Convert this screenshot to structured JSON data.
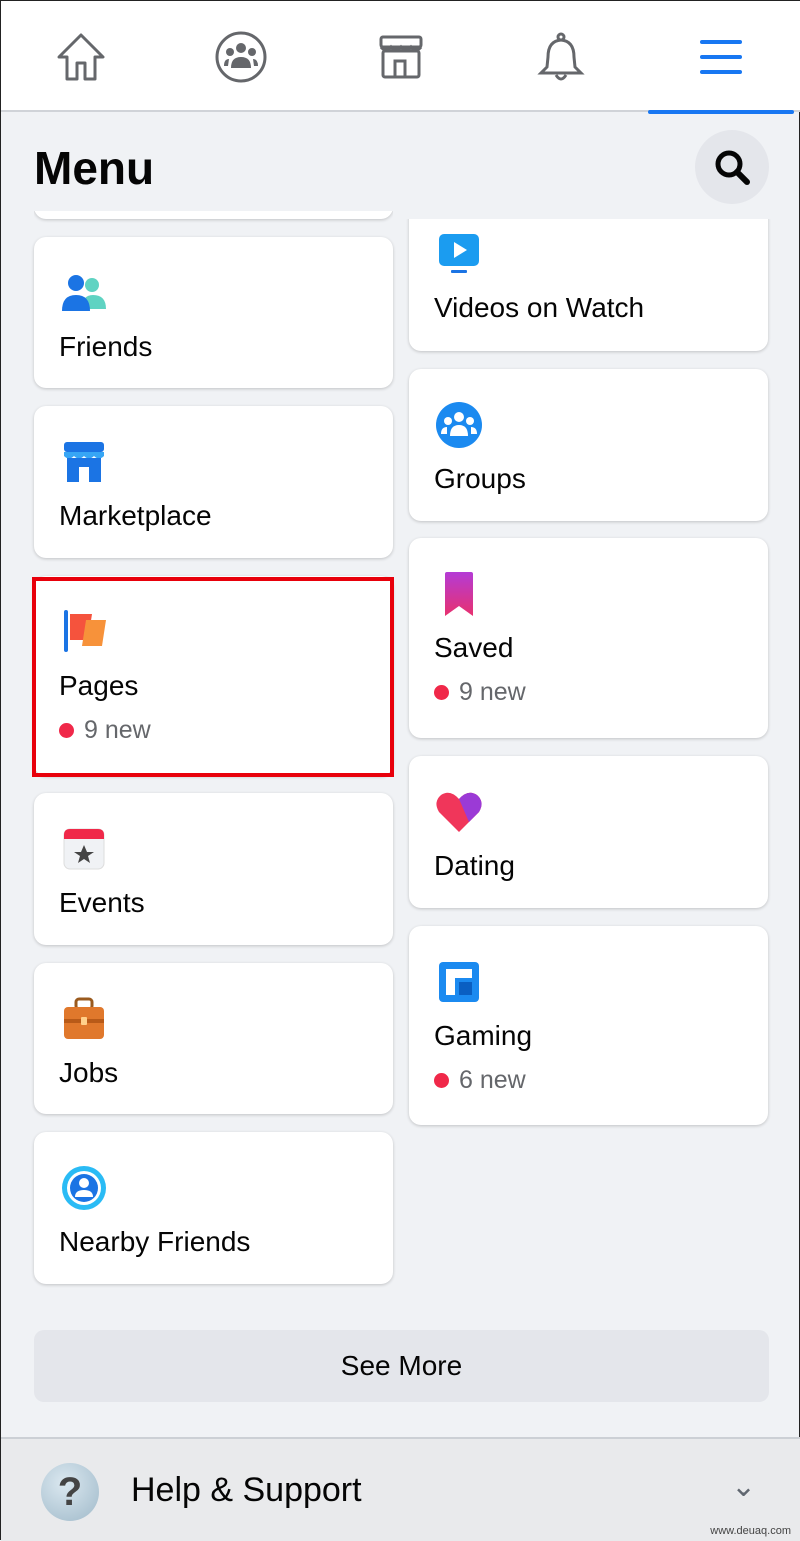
{
  "nav": {
    "tabs": [
      {
        "icon": "home-icon"
      },
      {
        "icon": "groups-icon"
      },
      {
        "icon": "marketplace-icon"
      },
      {
        "icon": "bell-icon"
      },
      {
        "icon": "menu-icon",
        "active": true
      }
    ]
  },
  "header": {
    "title": "Menu",
    "search_icon": "search-icon"
  },
  "left": [
    {
      "label": "Friends",
      "icon": "friends-icon"
    },
    {
      "label": "Marketplace",
      "icon": "marketplace-icon"
    },
    {
      "label": "Pages",
      "icon": "pages-flag-icon",
      "badge": "9 new",
      "highlighted": true
    },
    {
      "label": "Events",
      "icon": "calendar-star-icon"
    },
    {
      "label": "Jobs",
      "icon": "briefcase-icon"
    },
    {
      "label": "Nearby Friends",
      "icon": "nearby-friends-icon"
    }
  ],
  "right": [
    {
      "label": "Videos on Watch",
      "icon": "watch-icon"
    },
    {
      "label": "Groups",
      "icon": "groups-icon"
    },
    {
      "label": "Saved",
      "icon": "bookmark-icon",
      "badge": "9 new"
    },
    {
      "label": "Dating",
      "icon": "heart-icon"
    },
    {
      "label": "Gaming",
      "icon": "gaming-icon",
      "badge": "6 new"
    }
  ],
  "see_more": "See More",
  "help": {
    "label": "Help & Support",
    "icon": "question-icon"
  },
  "watermark": "www.deuaq.com",
  "colors": {
    "accent": "#1877f2",
    "badge_dot": "#f02849",
    "highlight": "#e8000b"
  }
}
